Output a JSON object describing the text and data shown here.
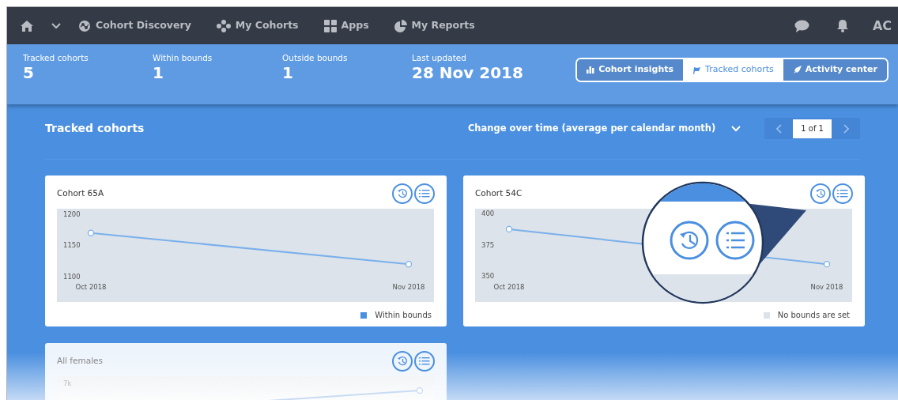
{
  "nav": {
    "items": [
      {
        "label": "Cohort Discovery"
      },
      {
        "label": "My Cohorts"
      },
      {
        "label": "Apps"
      },
      {
        "label": "My Reports"
      }
    ],
    "user_initials": "AC"
  },
  "stats": [
    {
      "label": "Tracked cohorts",
      "value": "5"
    },
    {
      "label": "Within bounds",
      "value": "1"
    },
    {
      "label": "Outside bounds",
      "value": "1"
    },
    {
      "label": "Last updated",
      "value": "28 Nov 2018"
    }
  ],
  "view_tabs": [
    {
      "label": "Cohort insights",
      "selected": false
    },
    {
      "label": "Tracked cohorts",
      "selected": true
    },
    {
      "label": "Activity center",
      "selected": false
    }
  ],
  "section": {
    "title": "Tracked cohorts",
    "metric_dropdown": {
      "label": "Change over time (average per calendar month)"
    },
    "pagination": {
      "text": "1 of 1"
    }
  },
  "cards": [
    {
      "title": "Cohort 65A",
      "faded": false,
      "chart_data": {
        "type": "line",
        "categories": [
          "Oct 2018",
          "Nov 2018"
        ],
        "series": [
          {
            "name": "Within bounds",
            "color": "#7ab0ec",
            "marker": "circle",
            "values": [
              1170,
              1120
            ]
          }
        ],
        "ylim": [
          1059.5,
          1208.9
        ],
        "yticks": [
          1200,
          1150,
          1100
        ]
      },
      "legend": {
        "color": "#4a8fe0"
      }
    },
    {
      "title": "Cohort 54C",
      "faded": false,
      "chart_data": {
        "type": "line",
        "categories": [
          "Oct 2018",
          "Nov 2018"
        ],
        "series": [
          {
            "name": "No bounds are set",
            "color": "#7ab0ec",
            "marker": "circle",
            "values": [
              388,
              360
            ]
          }
        ],
        "ylim": [
          329.7,
          404.4
        ],
        "yticks": [
          400,
          375,
          350
        ]
      },
      "legend": {
        "color": "#dce3ea"
      },
      "magnified": true
    },
    {
      "title": "All females",
      "faded": true,
      "axis_label": "7k"
    }
  ]
}
